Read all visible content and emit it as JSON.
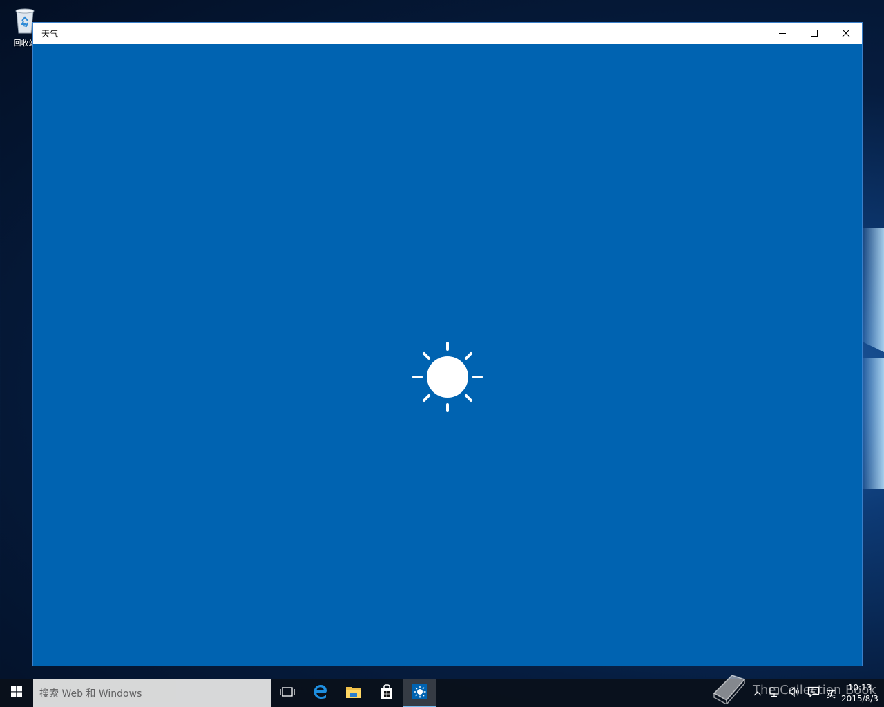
{
  "desktop": {
    "recycle_bin_label": "回收站"
  },
  "window": {
    "title": "天气",
    "minimize_icon": "minimize-icon",
    "maximize_icon": "maximize-icon",
    "close_icon": "close-icon",
    "background_color": "#0063b1",
    "splash_icon": "sun-icon"
  },
  "taskbar": {
    "search_placeholder": "搜索 Web 和 Windows",
    "pinned": [
      {
        "name": "task-view-icon"
      },
      {
        "name": "edge-icon"
      },
      {
        "name": "file-explorer-icon"
      },
      {
        "name": "store-icon"
      },
      {
        "name": "weather-icon",
        "active": true
      }
    ],
    "tray": {
      "input_language": "英",
      "time": "10:13",
      "date": "2015/8/3"
    }
  },
  "watermark": {
    "text": "The Collection Book"
  }
}
